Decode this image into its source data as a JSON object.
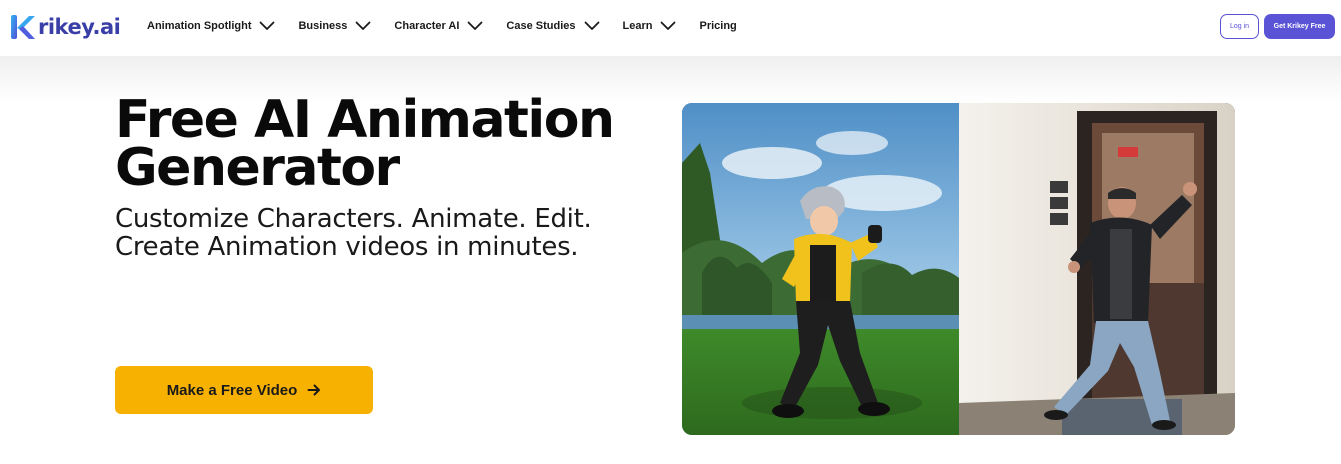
{
  "brand": {
    "logo_text": "rikey.ai",
    "logo_icon": "krikey-k-icon",
    "accent_color": "#5b53d6"
  },
  "nav": {
    "items": [
      {
        "label": "Animation Spotlight",
        "has_dropdown": true
      },
      {
        "label": "Business",
        "has_dropdown": true
      },
      {
        "label": "Character AI",
        "has_dropdown": true
      },
      {
        "label": "Case Studies",
        "has_dropdown": true
      },
      {
        "label": "Learn",
        "has_dropdown": true
      },
      {
        "label": "Pricing",
        "has_dropdown": false
      }
    ],
    "login_label": "Log in",
    "get_free_label": "Get Krikey Free"
  },
  "hero": {
    "title": "Free AI Animation Generator",
    "subtitle_line1": "Customize Characters. Animate. Edit.",
    "subtitle_line2": "Create Animation videos in minutes.",
    "cta_label": "Make a Free Video",
    "cta_icon": "arrow-right-icon",
    "cta_color": "#f7b100"
  },
  "media": {
    "left_panel": "animated-3d-character-scene",
    "right_panel": "live-action-person-video"
  }
}
